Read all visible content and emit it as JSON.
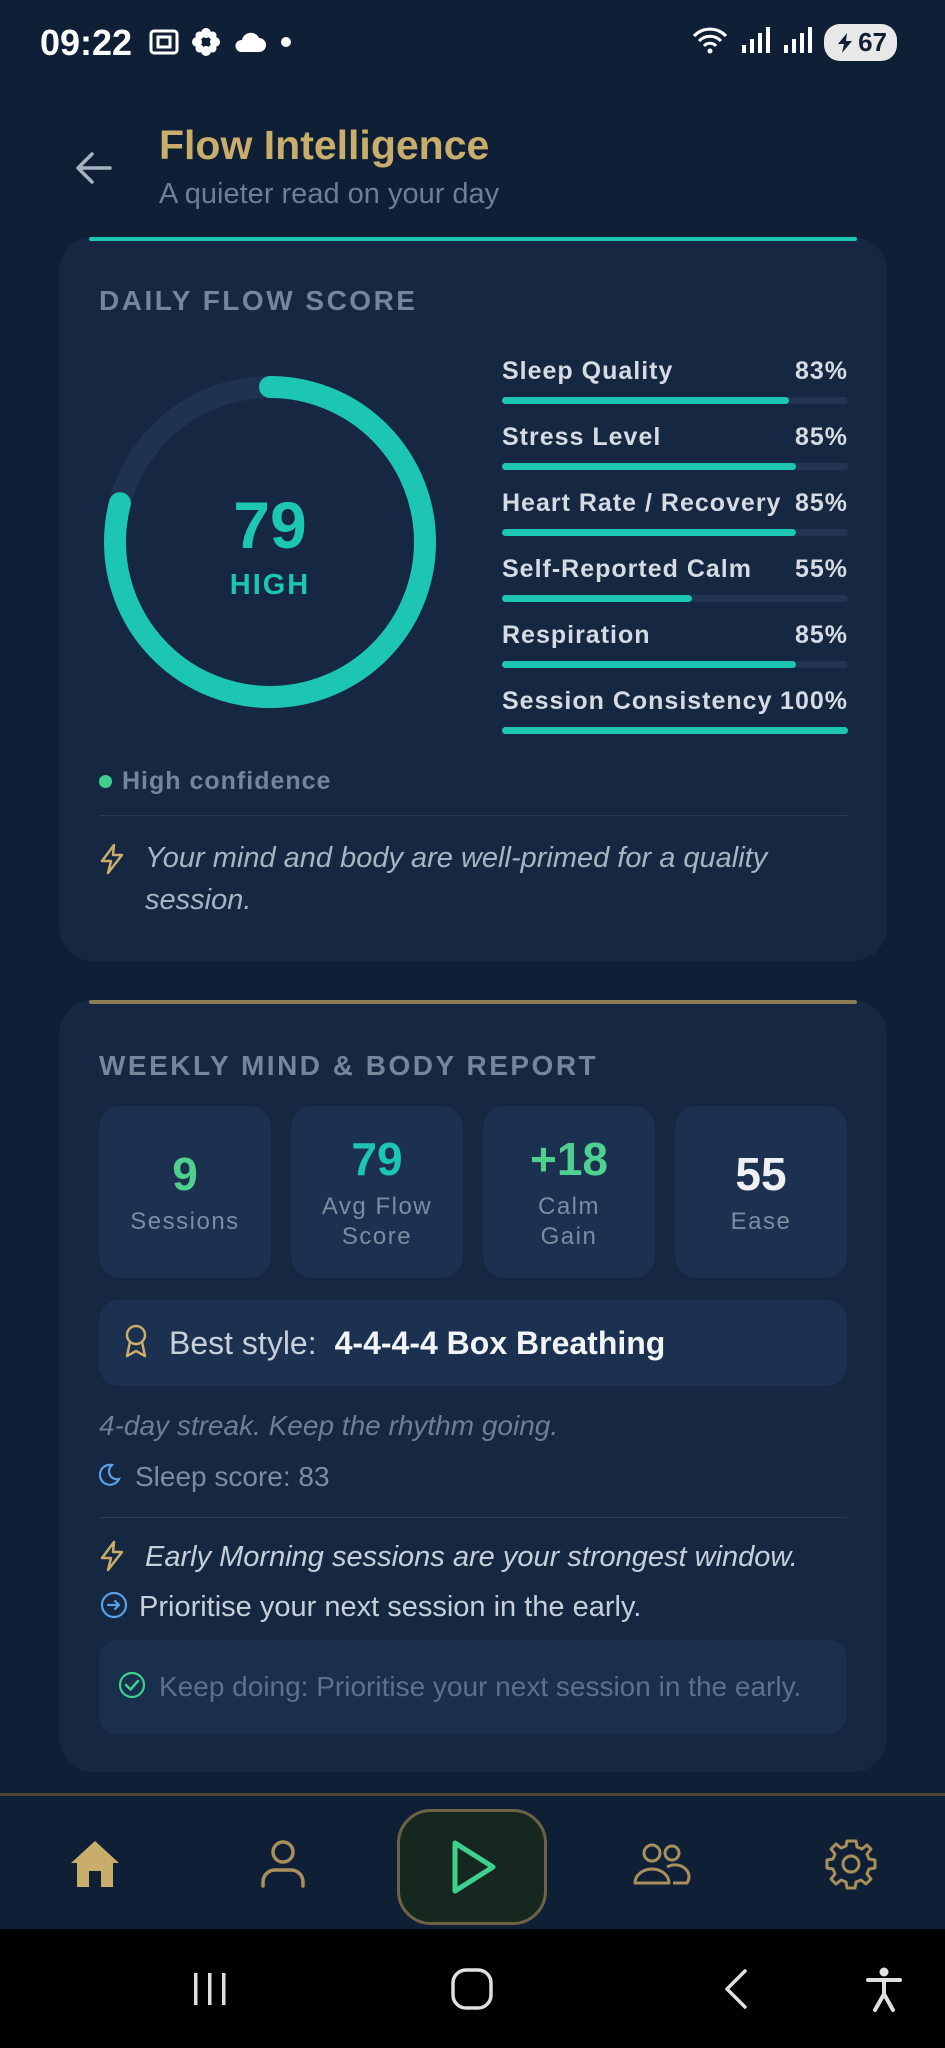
{
  "status_bar": {
    "time": "09:22",
    "battery": "67"
  },
  "header": {
    "title": "Flow Intelligence",
    "subtitle": "A quieter read on your day"
  },
  "flow_card": {
    "heading": "DAILY FLOW SCORE",
    "score": "79",
    "score_fraction": 0.79,
    "score_label": "HIGH",
    "metrics": [
      {
        "name": "Sleep Quality",
        "value": "83%",
        "level": 0.83
      },
      {
        "name": "Stress Level",
        "value": "85%",
        "level": 0.85
      },
      {
        "name": "Heart Rate / Recovery",
        "value": "85%",
        "level": 0.85
      },
      {
        "name": "Self-Reported Calm",
        "value": "55%",
        "level": 0.55
      },
      {
        "name": "Respiration",
        "value": "85%",
        "level": 0.85
      },
      {
        "name": "Session Consistency",
        "value": "100%",
        "level": 1.0
      }
    ],
    "confidence": "High confidence",
    "insight": "Your mind and body are well-primed for a quality session."
  },
  "weekly_card": {
    "heading": "WEEKLY MIND & BODY REPORT",
    "stats": [
      {
        "value": "9",
        "label": "Sessions",
        "color": "#4fd08f"
      },
      {
        "value": "79",
        "label": "Avg Flow\nScore",
        "color": "#1dc6b3"
      },
      {
        "value": "+18",
        "label": "Calm\nGain",
        "color": "#4fd08f"
      },
      {
        "value": "55",
        "label": "Ease",
        "color": "#eef0f3"
      }
    ],
    "best_style_prefix": "Best style:",
    "best_style": "4-4-4-4 Box Breathing",
    "streak": "4-day streak. Keep the rhythm going.",
    "sleep_score": "Sleep score: 83",
    "window_insight": "Early Morning sessions are your strongest window.",
    "next_action": "Prioritise your next session in the early.",
    "keep_doing": "Keep doing: Prioritise your next session in the early."
  },
  "colors": {
    "accent_teal": "#1dc6b3",
    "accent_gold": "#c9ad6a",
    "background": "#0f1f35",
    "card": "#152741"
  }
}
